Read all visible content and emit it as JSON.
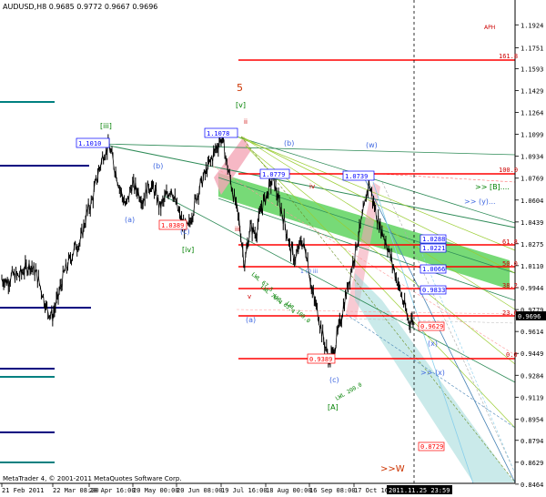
{
  "window": {
    "title": "AUDUSD,H8  0.9685 0.9772 0.9667 0.9696",
    "copyright": "MetaTrader 4, © 2001-2011 MetaQuotes Software Corp.",
    "corner_label": "APH"
  },
  "chart_data": {
    "type": "candlestick",
    "symbol": "AUDUSD",
    "timeframe": "H8",
    "ohlc_last": {
      "open": 0.9685,
      "high": 0.9772,
      "low": 0.9667,
      "close": 0.9696
    },
    "current_price": "0.9696",
    "ylim": [
      0.847,
      1.207
    ],
    "y_ticks": [
      "1.1924",
      "1.1751",
      "1.1593",
      "1.1429",
      "1.1264",
      "1.1099",
      "1.0934",
      "1.0769",
      "1.0604",
      "1.0439",
      "1.0275",
      "1.0110",
      "0.9944",
      "0.9779",
      "0.9614",
      "0.9449",
      "0.9284",
      "0.9119",
      "0.8954",
      "0.8794",
      "0.8629",
      "0.8464"
    ],
    "x_ticks": [
      "21 Feb 2011",
      "22 Mar 08:00",
      "20 Apr 16:00",
      "20 May 00:00",
      "20 Jun 08:00",
      "19 Jul 16:00",
      "18 Aug 00:00",
      "16 Sep 08:00",
      "17 Oct 16:00",
      "2011.11.25 23:59"
    ],
    "price_path": [
      [
        0,
        1.001
      ],
      [
        1,
        0.999
      ],
      [
        2,
        1.004
      ],
      [
        3,
        1.003
      ],
      [
        4,
        1.008
      ],
      [
        5,
        1.012
      ],
      [
        6,
        1.006
      ],
      [
        7,
        0.993
      ],
      [
        8,
        0.978
      ],
      [
        9,
        0.973
      ],
      [
        10,
        0.988
      ],
      [
        11,
        1.005
      ],
      [
        12,
        1.015
      ],
      [
        13,
        1.025
      ],
      [
        14,
        1.03
      ],
      [
        15,
        1.05
      ],
      [
        16,
        1.06
      ],
      [
        17,
        1.08
      ],
      [
        18,
        1.095
      ],
      [
        19,
        1.101
      ],
      [
        20,
        1.085
      ],
      [
        21,
        1.068
      ],
      [
        22,
        1.055
      ],
      [
        23,
        1.072
      ],
      [
        24,
        1.068
      ],
      [
        25,
        1.06
      ],
      [
        26,
        1.072
      ],
      [
        27,
        1.068
      ],
      [
        28,
        1.055
      ],
      [
        29,
        1.062
      ],
      [
        30,
        1.07
      ],
      [
        31,
        1.055
      ],
      [
        32,
        1.042
      ],
      [
        33,
        1.0389
      ],
      [
        34,
        1.055
      ],
      [
        35,
        1.07
      ],
      [
        36,
        1.08
      ],
      [
        37,
        1.09
      ],
      [
        38,
        1.1
      ],
      [
        39,
        1.1078
      ],
      [
        40,
        1.085
      ],
      [
        41,
        1.065
      ],
      [
        42,
        1.045
      ],
      [
        43,
        1.012
      ],
      [
        44,
        1.04
      ],
      [
        45,
        1.035
      ],
      [
        46,
        1.055
      ],
      [
        47,
        1.065
      ],
      [
        48,
        1.0779
      ],
      [
        49,
        1.06
      ],
      [
        50,
        1.045
      ],
      [
        51,
        1.025
      ],
      [
        52,
        1.015
      ],
      [
        53,
        1.03
      ],
      [
        54,
        1.02
      ],
      [
        55,
        0.99
      ],
      [
        56,
        0.975
      ],
      [
        57,
        0.955
      ],
      [
        58,
        0.9389
      ],
      [
        59,
        0.95
      ],
      [
        60,
        0.97
      ],
      [
        61,
        0.99
      ],
      [
        62,
        1.01
      ],
      [
        63,
        1.03
      ],
      [
        64,
        1.05
      ],
      [
        65,
        1.0739
      ],
      [
        66,
        1.055
      ],
      [
        67,
        1.04
      ],
      [
        68,
        1.03
      ],
      [
        69,
        1.015
      ],
      [
        70,
        1.0
      ],
      [
        71,
        0.985
      ],
      [
        72,
        0.97
      ],
      [
        73,
        0.9696
      ]
    ],
    "price_labels": [
      "1.1010",
      "1.0389",
      "1.1078",
      "1.0779",
      "1.0739",
      "0.9389",
      "1.0288",
      "1.0221",
      "1.0066",
      "0.9833",
      "0.9629",
      "0.8729"
    ],
    "wave_labels": [
      "[iii]",
      "(b)",
      "(a)",
      "(c)",
      "[iv]",
      "5",
      "[v]",
      "ii",
      "iii",
      "iv",
      "v",
      "(b)",
      "(a)",
      "(c)",
      "(w)",
      "[A]",
      ">> [B]....",
      ">> (y)...",
      "(x)",
      ">> (x)",
      ">>W",
      "1 (i) iii"
    ],
    "fib_levels": [
      "161.8",
      "100.0",
      "61.8",
      "50.0",
      "38.2",
      "23.6",
      "0.0"
    ],
    "trendline_labels": [
      "LWL 67.5",
      "LWL 76.4",
      "LWL 85.4",
      "LWL 100.0",
      "LWL 200.0"
    ]
  }
}
